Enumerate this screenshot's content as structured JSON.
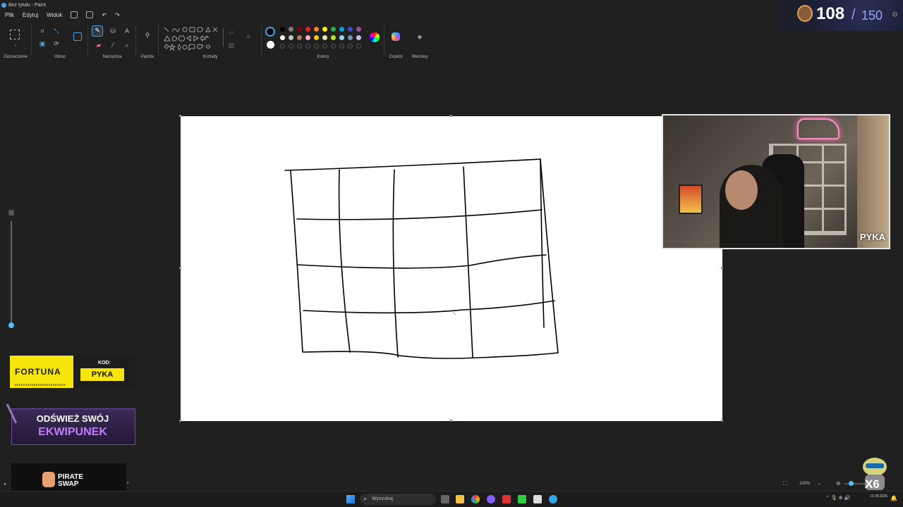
{
  "title_bar": {
    "title": "Bez tytułu - Paint"
  },
  "menu": {
    "items": [
      "Plik",
      "Edytuj",
      "Widok"
    ]
  },
  "ribbon": {
    "groups": {
      "selection": "Zaznaczenie",
      "image": "Obraz",
      "tools": "Narzędzia",
      "brushes": "Pędzle",
      "shapes": "Kształty",
      "colors": "Kolory",
      "copilot": "Copilot",
      "layers": "Warstwy"
    },
    "palette_row1": [
      "#000000",
      "#7f7f7f",
      "#880015",
      "#ed1c24",
      "#ff7f27",
      "#fff200",
      "#22b14c",
      "#00a2e8",
      "#3f48cc",
      "#a349a4"
    ],
    "palette_row2": [
      "#ffffff",
      "#c3c3c3",
      "#b97a57",
      "#ffaec9",
      "#ffc90e",
      "#efe4b0",
      "#b5e61d",
      "#99d9ea",
      "#7092be",
      "#c8bfe7"
    ],
    "primary_color": "#000000",
    "secondary_color": "#ffffff"
  },
  "stream_hud": {
    "count": "108",
    "separator": "/",
    "max": "150"
  },
  "webcam": {
    "streamer_name": "PYKA"
  },
  "sponsor_fortuna": {
    "brand": "FORTUNA",
    "code_label": "KOD:",
    "code": "PYKA"
  },
  "promo_ekwipunek": {
    "line1": "ODŚWIEŻ SWÓJ",
    "line2": "EKWIPUNEK"
  },
  "sponsor_pirate": {
    "line1": "PIRATE",
    "line2": "SWAP"
  },
  "status_bar": {
    "zoom": "100%",
    "caret": "⌄"
  },
  "mascot": {
    "label": "X6"
  },
  "taskbar": {
    "search_placeholder": "Wyszukaj",
    "date": "12.08.2025"
  }
}
